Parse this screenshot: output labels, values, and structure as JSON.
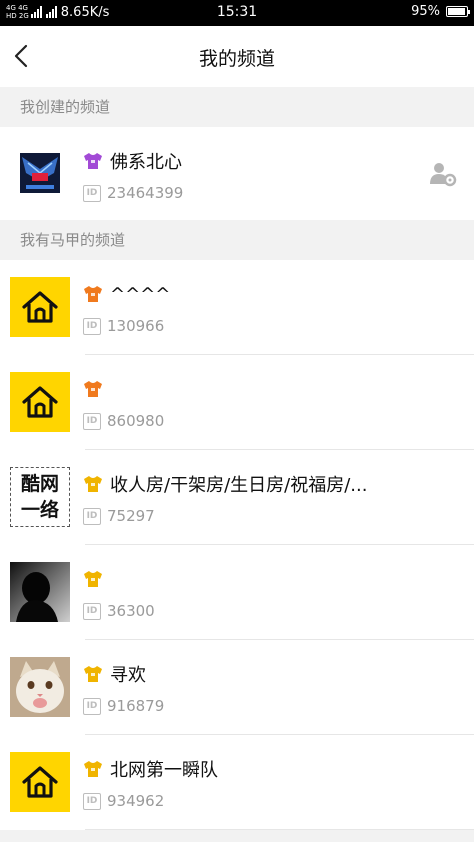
{
  "status_bar": {
    "network_tag_top": "4G 4G",
    "network_tag_bottom": "HD 2G",
    "speed": "8.65K/s",
    "time": "15:31",
    "battery": "95%",
    "battery_level": 0.95
  },
  "nav": {
    "title": "我的频道",
    "back_icon": "chevron-left-icon"
  },
  "sections": {
    "created": {
      "label": "我创建的频道"
    },
    "alias": {
      "label": "我有马甲的频道"
    }
  },
  "created_channels": [
    {
      "name": "佛系北心",
      "id_label": "ID",
      "id": "23464399",
      "badge_color": "#a24ad6",
      "avatar_type": "logo-dark",
      "manage_icon": "user-gear-icon"
    }
  ],
  "alias_channels": [
    {
      "name": "^^^^",
      "id_label": "ID",
      "id": "130966",
      "badge_color": "#f07a1e",
      "avatar_type": "house"
    },
    {
      "name": "",
      "id_label": "ID",
      "id": "860980",
      "badge_color": "#f07a1e",
      "avatar_type": "house"
    },
    {
      "name": "收人房/干架房/生日房/祝福房/...",
      "id_label": "ID",
      "id": "75297",
      "badge_color": "#f0b400",
      "avatar_type": "text-logo",
      "avatar_text": "酷网一络"
    },
    {
      "name": "",
      "id_label": "ID",
      "id": "36300",
      "badge_color": "#f0b400",
      "avatar_type": "dark-photo"
    },
    {
      "name": "寻欢",
      "id_label": "ID",
      "id": "916879",
      "badge_color": "#f0b400",
      "avatar_type": "cat-photo"
    },
    {
      "name": "北网第一瞬队",
      "id_label": "ID",
      "id": "934962",
      "badge_color": "#f0b400",
      "avatar_type": "house"
    }
  ]
}
